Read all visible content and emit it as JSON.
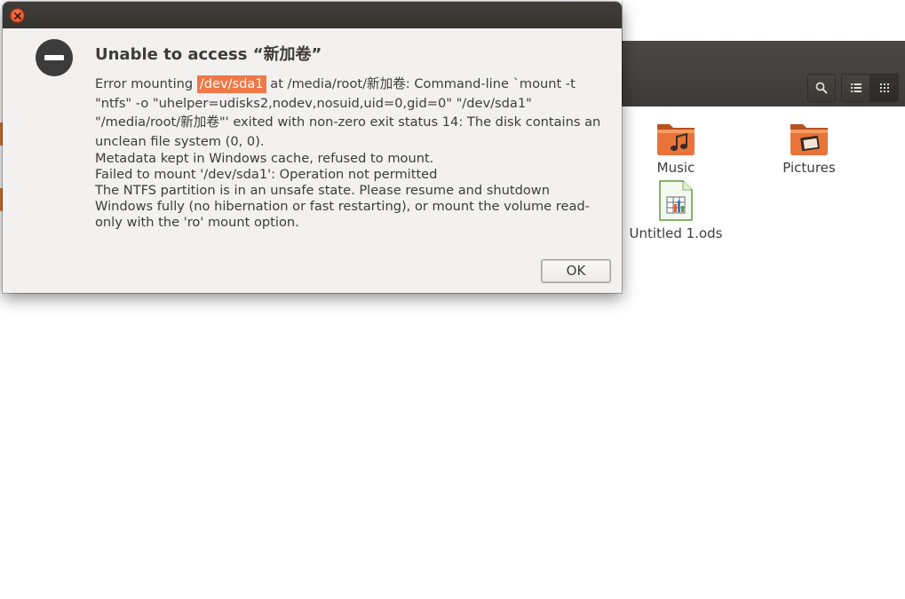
{
  "dialog": {
    "title": "Unable to access “新加卷”",
    "message": {
      "line1_prefix": "Error mounting ",
      "line1_device": "/dev/sda1",
      "line1_rest": " at /media/root/新加卷: Command-line `mount -t \"ntfs\" -o \"uhelper=udisks2,nodev,nosuid,uid=0,gid=0\" \"/dev/sda1\" \"/media/root/新加卷\"' exited with non-zero exit status 14: The disk contains an unclean file system (0, 0).",
      "line2": "Metadata kept in Windows cache, refused to mount.",
      "line3": "Failed to mount '/dev/sda1': Operation not permitted",
      "line4": "The NTFS partition is in an unsafe state. Please resume and shutdown Windows fully (no hibernation or fast restarting), or mount the volume read-only with the 'ro' mount option."
    },
    "ok_label": "OK",
    "icon": "error-icon",
    "close_icon": "close-icon"
  },
  "files_window": {
    "toolbar": {
      "search_icon": "search-icon",
      "list_view_icon": "list-view-icon",
      "grid_view_icon": "grid-view-icon"
    },
    "items": [
      {
        "label": "Music",
        "icon": "music-folder-icon"
      },
      {
        "label": "Pictures",
        "icon": "pictures-folder-icon"
      },
      {
        "label": "Untitled 1.ods",
        "icon": "spreadsheet-file-icon"
      }
    ]
  },
  "colors": {
    "accent": "#f07746",
    "close_button": "#e35d33",
    "headerbar": "#3c3b37",
    "dialog_bg": "#f2f1f0",
    "text": "#3c3c3c"
  }
}
